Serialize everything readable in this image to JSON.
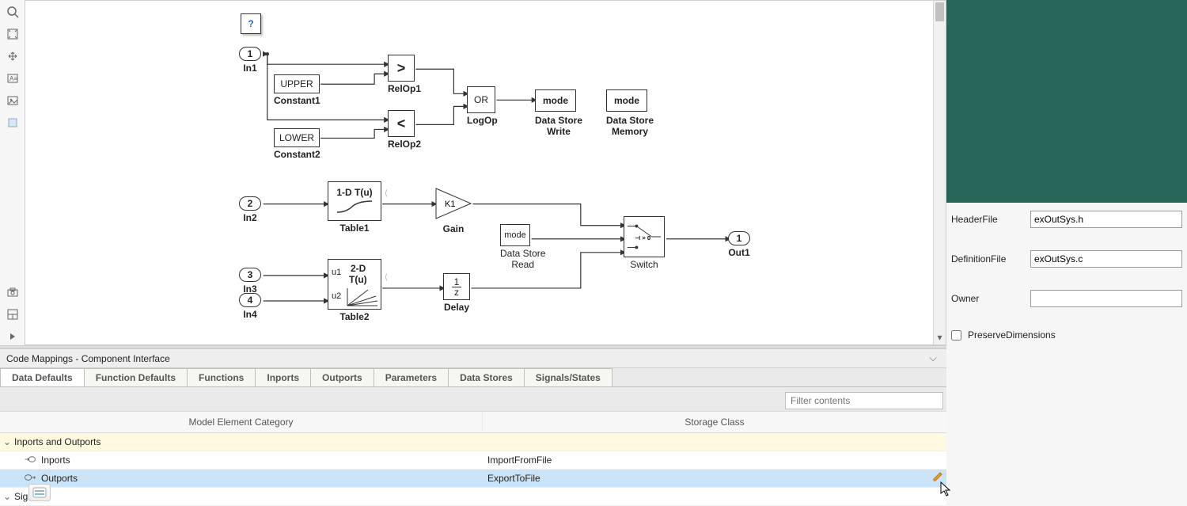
{
  "canvas": {
    "aboutThisExample": "?",
    "in1": {
      "num": "1",
      "label": "In1"
    },
    "in2": {
      "num": "2",
      "label": "In2"
    },
    "in3": {
      "num": "3",
      "label": "In3"
    },
    "in4": {
      "num": "4",
      "label": "In4"
    },
    "out1": {
      "num": "1",
      "label": "Out1"
    },
    "upper": {
      "text": "UPPER",
      "label": "Constant1"
    },
    "lower": {
      "text": "LOWER",
      "label": "Constant2"
    },
    "relop1": {
      "text": ">",
      "label": "RelOp1"
    },
    "relop2": {
      "text": "<",
      "label": "RelOp2"
    },
    "logop": {
      "text": "OR",
      "label": "LogOp"
    },
    "dsw": {
      "text": "mode",
      "label1": "Data Store",
      "label2": "Write"
    },
    "dsm": {
      "text": "mode",
      "label1": "Data Store",
      "label2": "Memory"
    },
    "table1": {
      "text": "1-D T(u)",
      "label": "Table1"
    },
    "table2": {
      "u1": "u1",
      "u2": "u2",
      "text1": "2-D",
      "text2": "T(u)",
      "label": "Table2"
    },
    "gain": {
      "text": "K1",
      "label": "Gain"
    },
    "dsr": {
      "text": "mode",
      "label1": "Data Store",
      "label2": "Read"
    },
    "switch": {
      "text": "⊣ > 0",
      "label": "Switch"
    },
    "delay": {
      "top": "1",
      "bot": "z",
      "label": "Delay"
    }
  },
  "codeMappings": {
    "title": "Code Mappings - Component Interface",
    "tabs": [
      "Data Defaults",
      "Function Defaults",
      "Functions",
      "Inports",
      "Outports",
      "Parameters",
      "Data Stores",
      "Signals/States"
    ],
    "activeTab": 0,
    "filterPlaceholder": "Filter contents",
    "columns": {
      "c1": "Model Element Category",
      "c2": "Storage Class"
    },
    "sections": [
      {
        "title": "Inports and Outports",
        "rows": [
          {
            "icon": "inport",
            "name": "Inports",
            "storage": "ImportFromFile",
            "selected": false
          },
          {
            "icon": "outport",
            "name": "Outports",
            "storage": "ExportToFile",
            "selected": true
          }
        ]
      },
      {
        "title": "Signals",
        "rows": []
      }
    ]
  },
  "props": {
    "headerFile": {
      "label": "HeaderFile",
      "value": "exOutSys.h"
    },
    "definitionFile": {
      "label": "DefinitionFile",
      "value": "exOutSys.c"
    },
    "owner": {
      "label": "Owner",
      "value": ""
    },
    "preserveDimensions": {
      "label": "PreserveDimensions",
      "checked": false
    }
  }
}
